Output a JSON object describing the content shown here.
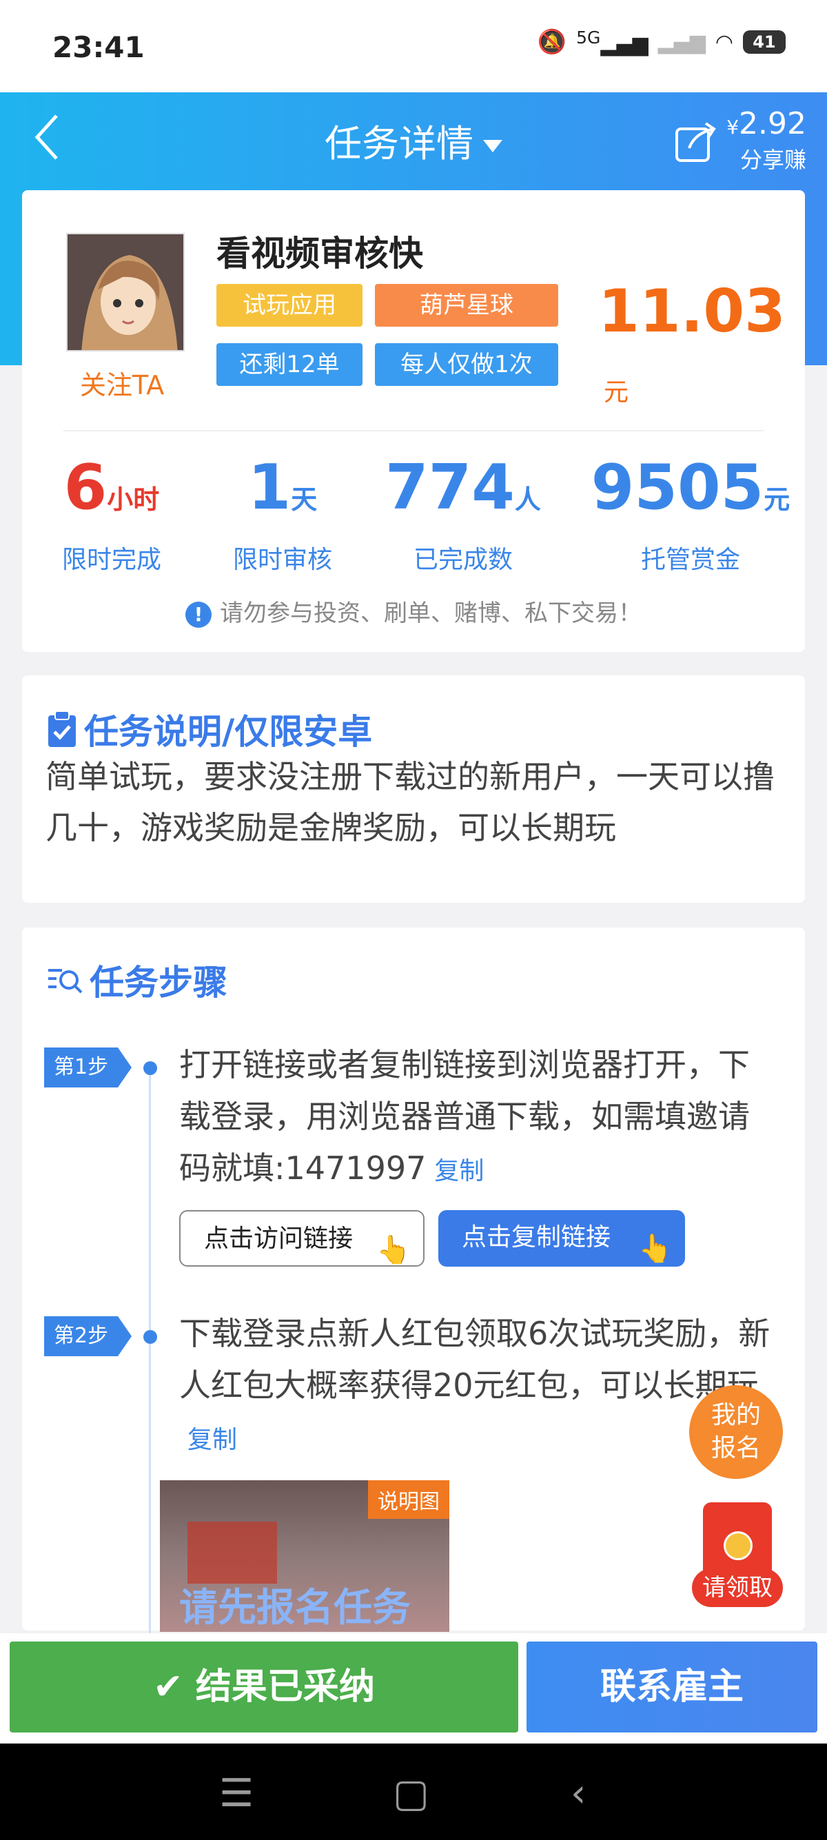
{
  "status": {
    "time": "23:41",
    "battery": "41",
    "network": "5G"
  },
  "header": {
    "title": "任务详情",
    "share_amount_symbol": "¥",
    "share_amount": "2.92",
    "share_label": "分享赚"
  },
  "task": {
    "app_name": "看视频审核快",
    "follow_label": "关注TA",
    "tags": [
      "试玩应用",
      "葫芦星球",
      "还剩12单",
      "每人仅做1次"
    ],
    "price": "11.03",
    "price_unit": "元"
  },
  "stats": [
    {
      "value": "6",
      "unit": "小时",
      "label": "限时完成",
      "color": "#e63a2e"
    },
    {
      "value": "1",
      "unit": "天",
      "label": "限时审核",
      "color": "#3a86e8"
    },
    {
      "value": "774",
      "unit": "人",
      "label": "已完成数",
      "color": "#3a86e8"
    },
    {
      "value": "9505",
      "unit": "元",
      "label": "托管赏金",
      "color": "#3a86e8"
    }
  ],
  "warning": "请勿参与投资、刷单、赌博、私下交易！",
  "description": {
    "title": "任务说明/仅限安卓",
    "text": "简单试玩，要求没注册下载过的新用户，一天可以撸几十，游戏奖励是金牌奖励，可以长期玩"
  },
  "steps": {
    "title": "任务步骤",
    "items": [
      {
        "badge": "第1步",
        "text": "打开链接或者复制链接到浏览器打开，下载登录，用浏览器普通下载，如需填邀请码就填:1471997",
        "copy": "复制"
      },
      {
        "badge": "第2步",
        "text": "下载登录点新人红包领取6次试玩奖励，新人红包大概率获得20元红包，可以长期玩",
        "copy": "复制"
      }
    ],
    "visit_button": "点击访问链接",
    "copy_link_button": "点击复制链接",
    "image_label": "说明图",
    "image_overlay": "请先报名任务"
  },
  "floating": {
    "my_signup_line1": "我的",
    "my_signup_line2": "报名",
    "claim": "请领取"
  },
  "bottom": {
    "accepted": "结果已采纳",
    "contact": "联系雇主"
  },
  "colors": {
    "accent": "#3a86e8",
    "price": "#f46b16",
    "green": "#4cae4c"
  }
}
